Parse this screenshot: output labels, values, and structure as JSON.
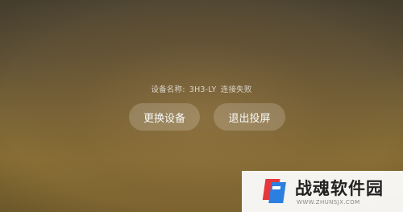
{
  "status": {
    "device_label": "设备名称:",
    "device_name": "3H3-LY",
    "message": "连接失败"
  },
  "buttons": {
    "switch_device": "更换设备",
    "exit_cast": "退出投屏"
  },
  "watermark": {
    "title": "战魂软件园",
    "url": "WWW.ZHUNSJX.COM",
    "icon": "watermark-logo-icon",
    "colors": {
      "red": "#e5373c",
      "blue": "#2b7fe0"
    }
  }
}
